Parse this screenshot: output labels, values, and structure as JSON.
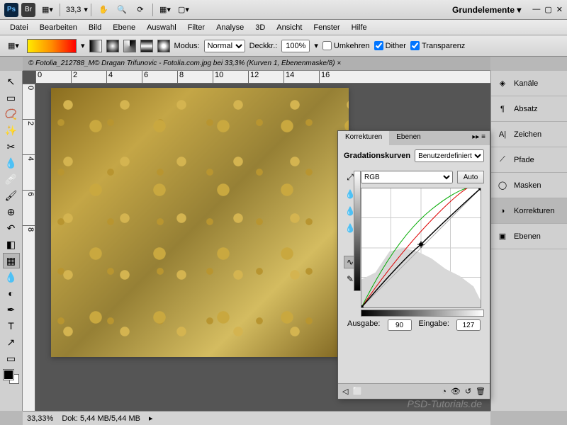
{
  "topbar": {
    "zoom": "33,3",
    "workspace": "Grundelemente ▾"
  },
  "menu": {
    "items": [
      "Datei",
      "Bearbeiten",
      "Bild",
      "Ebene",
      "Auswahl",
      "Filter",
      "Analyse",
      "3D",
      "Ansicht",
      "Fenster",
      "Hilfe"
    ]
  },
  "options": {
    "modus_label": "Modus:",
    "modus_value": "Normal",
    "deckk_label": "Deckkr.:",
    "deckk_value": "100%",
    "umkehren": "Umkehren",
    "dither": "Dither",
    "transparenz": "Transparenz"
  },
  "doc": {
    "title": "© Fotolia_212788_M© Dragan Trifunovic - Fotolia.com.jpg bei 33,3% (Kurven 1, Ebenenmaske/8) ×"
  },
  "ruler_h": [
    "0",
    "2",
    "4",
    "6",
    "8",
    "10",
    "12",
    "14",
    "16"
  ],
  "ruler_v": [
    "0",
    "2",
    "4",
    "6",
    "8"
  ],
  "panels": {
    "items": [
      {
        "label": "Kanäle"
      },
      {
        "label": "Absatz"
      },
      {
        "label": "Zeichen"
      },
      {
        "label": "Pfade"
      },
      {
        "label": "Masken"
      },
      {
        "label": "Korrekturen"
      },
      {
        "label": "Ebenen"
      }
    ]
  },
  "curves": {
    "tab1": "Korrekturen",
    "tab2": "Ebenen",
    "title": "Gradationskurven",
    "preset": "Benutzerdefiniert",
    "channel": "RGB",
    "auto": "Auto",
    "output_label": "Ausgabe:",
    "output_value": "90",
    "input_label": "Eingabe:",
    "input_value": "127"
  },
  "status": {
    "zoom": "33,33%",
    "doc": "Dok: 5,44 MB/5,44 MB"
  },
  "watermark": "PSD-Tutorials.de"
}
